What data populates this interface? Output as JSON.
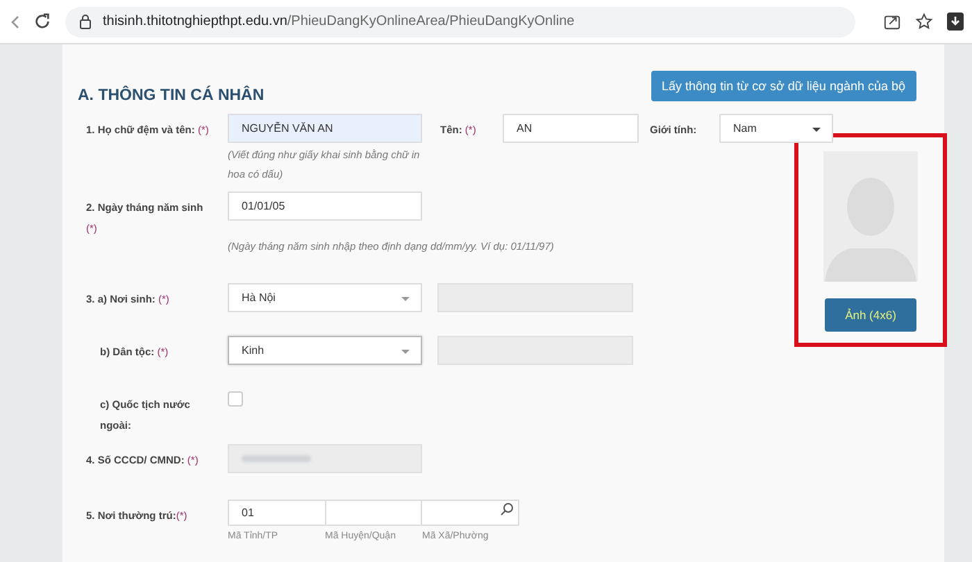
{
  "browser": {
    "url_host": "thisinh.thitotnghiepthpt.edu.vn",
    "url_path": "/PhieuDangKyOnlineArea/PhieuDangKyOnline"
  },
  "section_title": "A. THÔNG TIN CÁ NHÂN",
  "fetch_button": "Lấy thông tin từ cơ sở dữ liệu ngành của bộ",
  "required_mark": "(*)",
  "full_name": {
    "label": "1. Họ chữ đệm và tên:",
    "value": "NGUYỄN VĂN AN",
    "hint": "(Viết đúng như giấy khai sinh bằng chữ in hoa có dấu)"
  },
  "given_name": {
    "label": "Tên:",
    "value": "AN"
  },
  "gender": {
    "label": "Giới tính:",
    "value": "Nam"
  },
  "birth_date": {
    "label": "2. Ngày tháng năm sinh",
    "value": "01/01/05",
    "hint": "(Ngày tháng năm sinh nhập theo định dạng dd/mm/yy. Ví dụ: 01/11/97)"
  },
  "birth_place": {
    "label": "3. a) Nơi sinh:",
    "value": "Hà Nội"
  },
  "ethnicity": {
    "label": "b) Dân tộc:",
    "value": "Kinh"
  },
  "foreign": {
    "label": "c) Quốc tịch nước ngoài:",
    "checked": false
  },
  "id_number": {
    "label": "4. Số CCCD/ CMND:"
  },
  "residence": {
    "label": "5. Nơi thường trú:",
    "fields": [
      {
        "value": "01",
        "caption": "Mã Tỉnh/TP"
      },
      {
        "caption": "Mã Huyện/Quận"
      },
      {
        "caption": "Mã Xã/Phường"
      }
    ]
  },
  "photo": {
    "button": "Ảnh (4x6)",
    "highlighted": true
  }
}
